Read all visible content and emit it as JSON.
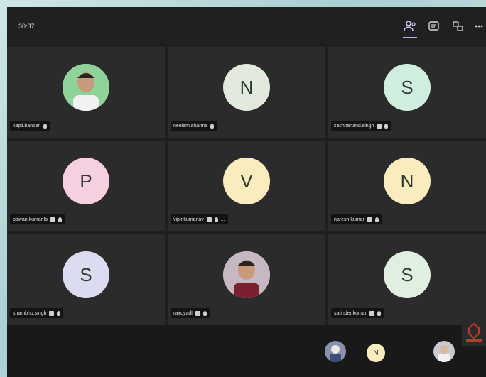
{
  "meeting": {
    "timer": "30:37",
    "toolbar": [
      {
        "name": "participants-icon",
        "active": true
      },
      {
        "name": "chat-icon",
        "active": false
      },
      {
        "name": "breakout-rooms-icon",
        "active": false
      },
      {
        "name": "more-options-icon",
        "active": false
      }
    ]
  },
  "participants": [
    {
      "name": "kapil.bansari",
      "initial": "",
      "avatar_color": "#8fd39b",
      "photo": true,
      "icons": [
        "mic-muted-icon"
      ]
    },
    {
      "name": "neelam.sharma",
      "initial": "N",
      "avatar_color": "#e2eadd",
      "photo": false,
      "icons": [
        "mic-muted-icon"
      ]
    },
    {
      "name": "sachitanand.singh",
      "initial": "S",
      "avatar_color": "#cfeedd",
      "photo": false,
      "icons": [
        "video-off-icon",
        "mic-muted-icon"
      ]
    },
    {
      "name": "pawan.kumar.lb",
      "initial": "P",
      "avatar_color": "#f6cfe0",
      "photo": false,
      "icons": [
        "video-off-icon",
        "mic-muted-icon"
      ]
    },
    {
      "name": "vipinkumar.av",
      "initial": "V",
      "avatar_color": "#fbecbe",
      "photo": false,
      "icons": [
        "video-off-icon",
        "mic-muted-icon"
      ],
      "more": "..."
    },
    {
      "name": "naresh.kumar",
      "initial": "N",
      "avatar_color": "#fbecbe",
      "photo": false,
      "icons": [
        "video-off-icon",
        "mic-muted-icon"
      ]
    },
    {
      "name": "shambhu.singh",
      "initial": "S",
      "avatar_color": "#dcdcf0",
      "photo": false,
      "icons": [
        "video-off-icon",
        "mic-muted-icon"
      ]
    },
    {
      "name": "rajroyadl",
      "initial": "",
      "avatar_color": "#c7b7c2",
      "photo": true,
      "icons": [
        "video-off-icon",
        "mic-muted-icon"
      ]
    },
    {
      "name": "satinder.kumar",
      "initial": "S",
      "avatar_color": "#e1efe1",
      "photo": false,
      "icons": [
        "video-off-icon",
        "mic-muted-icon"
      ]
    }
  ],
  "bottom_strip": [
    {
      "name": "participant-thumb-photo-1",
      "initial": "",
      "color": "#9da3b8"
    },
    {
      "name": "participant-thumb-n",
      "initial": "N",
      "color": "#fbecbe"
    },
    {
      "name": "participant-thumb-photo-2",
      "initial": "",
      "color": "#c9c9cf"
    }
  ]
}
